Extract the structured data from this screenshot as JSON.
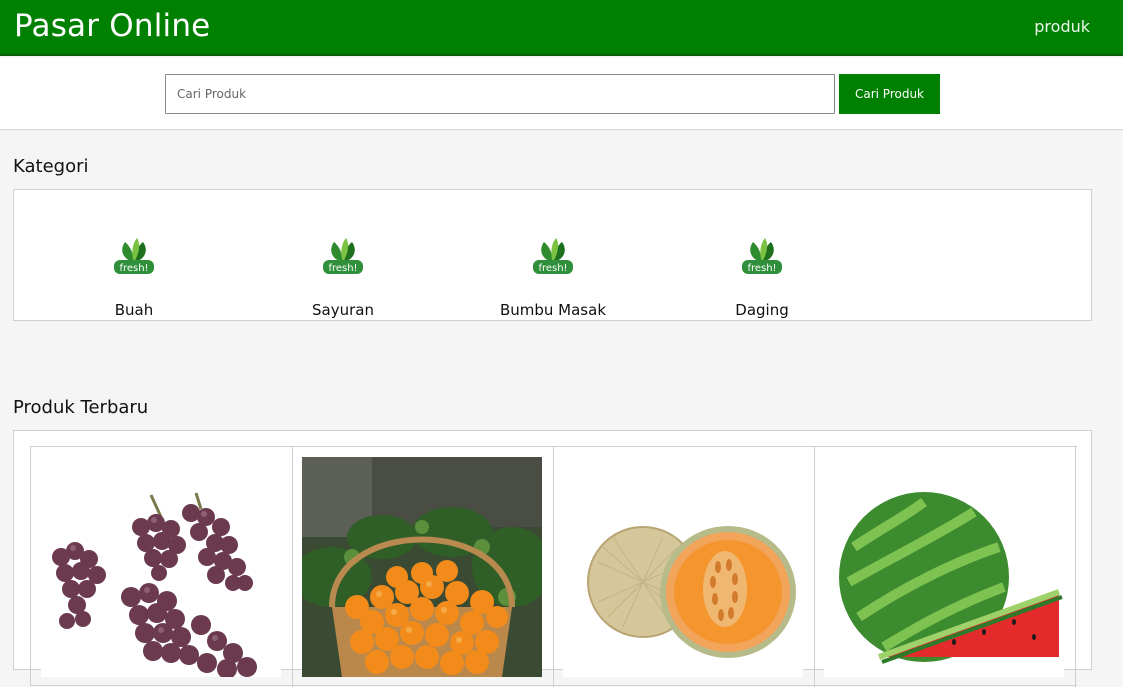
{
  "app": {
    "brand": "Pasar Online"
  },
  "nav": {
    "produk_link": "produk"
  },
  "search": {
    "placeholder": "Cari Produk",
    "value": "",
    "button_label": "Cari Produk"
  },
  "kategori": {
    "title": "Kategori",
    "logo_text": "fresh!",
    "items": [
      {
        "label": "Buah",
        "icon": "fresh-logo-icon"
      },
      {
        "label": "Sayuran",
        "icon": "fresh-logo-icon"
      },
      {
        "label": "Bumbu Masak",
        "icon": "fresh-logo-icon"
      },
      {
        "label": "Daging",
        "icon": "fresh-logo-icon"
      }
    ]
  },
  "produk_terbaru": {
    "title": "Produk Terbaru",
    "items": [
      {
        "image": "grapes"
      },
      {
        "image": "oranges-in-basket"
      },
      {
        "image": "cantaloupe-melon"
      },
      {
        "image": "watermelon"
      }
    ]
  },
  "colors": {
    "primary": "#008000",
    "primary_dark": "#0a5d0a",
    "background": "#f5f5f5"
  }
}
